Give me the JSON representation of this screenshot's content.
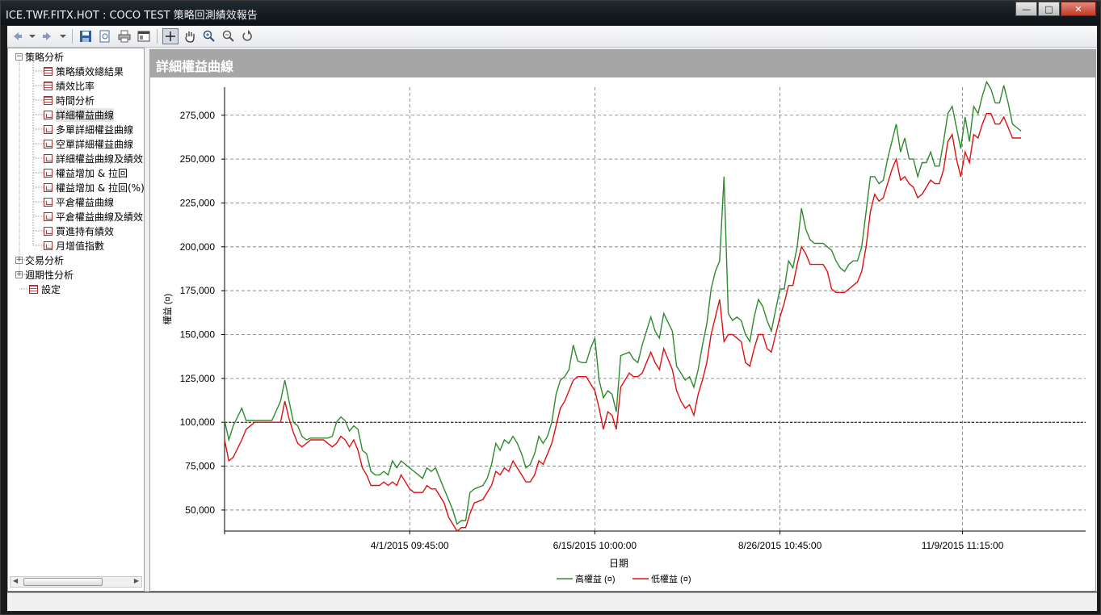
{
  "window": {
    "title": "ICE.TWF.FITX.HOT : COCO TEST 策略回測績效報告",
    "buttons": {
      "minimize": "—",
      "maximize": "□",
      "close": "✕"
    }
  },
  "toolbar": {
    "items": [
      "back-icon",
      "dropdown-icon",
      "forward-icon",
      "dropdown-icon",
      "save-icon",
      "export-icon",
      "print-icon",
      "settings-icon",
      "pointer-icon",
      "hand-pan-icon",
      "zoom-in-icon",
      "zoom-out-icon",
      "reset-zoom-icon"
    ]
  },
  "tree": {
    "root1": "策略分析",
    "children": [
      "策略績效總結果",
      "績效比率",
      "時間分析",
      "詳細權益曲線",
      "多單詳細權益曲線",
      "空單詳細權益曲線",
      "詳細權益曲線及績效",
      "權益增加 & 拉回",
      "權益增加 & 拉回(%)",
      "平倉權益曲線",
      "平倉權益曲線及績效",
      "買進持有績效",
      "月增值指數"
    ],
    "root2": "交易分析",
    "root3": "週期性分析",
    "root4": "設定"
  },
  "panel": {
    "title": "詳細權益曲線"
  },
  "chart_data": {
    "type": "line",
    "title": "",
    "xlabel": "日期",
    "ylabel": "權益 (¤)",
    "ylim": [
      38000,
      291000
    ],
    "yticks": [
      50000,
      75000,
      100000,
      125000,
      150000,
      175000,
      200000,
      225000,
      250000,
      275000
    ],
    "ytick_labels": [
      "50,000",
      "75,000",
      "100,000",
      "125,000",
      "150,000",
      "175,000",
      "200,000",
      "225,000",
      "250,000",
      "275,000"
    ],
    "xtick_labels": [
      "4/1/2015 09:45:00",
      "6/15/2015 10:00:00",
      "8/26/2015 10:45:00",
      "11/9/2015 11:15:00"
    ],
    "xtick_positions": [
      0.215,
      0.43,
      0.645,
      0.857
    ],
    "reference_line": 100000,
    "grid": true,
    "legend_position": "bottom-center",
    "colors": {
      "high": "#2e8b2e",
      "low": "#dd1111"
    },
    "series": [
      {
        "name": "高權益 (¤)",
        "color": "#2e8b2e"
      },
      {
        "name": "低權益 (¤)",
        "color": "#dd1111"
      }
    ],
    "x": [
      0,
      0.005,
      0.01,
      0.02,
      0.025,
      0.035,
      0.045,
      0.05,
      0.055,
      0.065,
      0.07,
      0.075,
      0.08,
      0.085,
      0.09,
      0.095,
      0.1,
      0.11,
      0.115,
      0.12,
      0.125,
      0.13,
      0.135,
      0.14,
      0.145,
      0.15,
      0.155,
      0.16,
      0.165,
      0.17,
      0.175,
      0.18,
      0.185,
      0.19,
      0.195,
      0.2,
      0.205,
      0.21,
      0.215,
      0.22,
      0.225,
      0.23,
      0.235,
      0.24,
      0.245,
      0.25,
      0.255,
      0.26,
      0.265,
      0.27,
      0.275,
      0.28,
      0.285,
      0.29,
      0.3,
      0.305,
      0.31,
      0.315,
      0.32,
      0.325,
      0.33,
      0.335,
      0.34,
      0.345,
      0.35,
      0.355,
      0.36,
      0.365,
      0.37,
      0.375,
      0.38,
      0.385,
      0.39,
      0.395,
      0.4,
      0.405,
      0.41,
      0.415,
      0.42,
      0.425,
      0.43,
      0.435,
      0.44,
      0.445,
      0.45,
      0.455,
      0.46,
      0.47,
      0.475,
      0.48,
      0.485,
      0.49,
      0.495,
      0.5,
      0.505,
      0.51,
      0.52,
      0.525,
      0.53,
      0.535,
      0.54,
      0.545,
      0.55,
      0.555,
      0.56,
      0.565,
      0.57,
      0.575,
      0.58,
      0.585,
      0.59,
      0.595,
      0.6,
      0.605,
      0.61,
      0.615,
      0.62,
      0.625,
      0.63,
      0.635,
      0.64,
      0.645,
      0.65,
      0.655,
      0.66,
      0.665,
      0.67,
      0.675,
      0.68,
      0.685,
      0.69,
      0.695,
      0.7,
      0.705,
      0.71,
      0.715,
      0.72,
      0.725,
      0.73,
      0.735,
      0.74,
      0.745,
      0.75,
      0.755,
      0.76,
      0.765,
      0.77,
      0.775,
      0.78,
      0.785,
      0.79,
      0.795,
      0.8,
      0.805,
      0.81,
      0.815,
      0.82,
      0.825,
      0.83,
      0.835,
      0.84,
      0.845,
      0.85,
      0.855,
      0.86,
      0.865,
      0.87,
      0.875,
      0.88,
      0.885,
      0.89,
      0.895,
      0.9,
      0.905,
      0.91,
      0.915,
      0.92,
      0.925,
      0.93,
      0.935,
      0.94,
      0.945,
      0.95,
      0.955,
      0.96,
      0.965,
      0.97,
      0.975,
      0.98,
      0.985,
      0.99,
      0.995,
      1.0
    ],
    "high": [
      101000,
      90000,
      98000,
      108000,
      101000,
      101000,
      101000,
      101000,
      101000,
      112000,
      124000,
      112000,
      100000,
      98000,
      92000,
      90000,
      91000,
      91000,
      91000,
      91000,
      92000,
      100000,
      103000,
      101000,
      95000,
      98000,
      96000,
      84000,
      82000,
      72000,
      70000,
      70000,
      72000,
      70000,
      78000,
      74000,
      78000,
      76000,
      74000,
      72000,
      70000,
      68000,
      74000,
      72000,
      74000,
      68000,
      62000,
      56000,
      50000,
      42000,
      44000,
      44000,
      60000,
      62000,
      64000,
      68000,
      76000,
      88000,
      84000,
      90000,
      88000,
      92000,
      88000,
      82000,
      74000,
      76000,
      82000,
      92000,
      88000,
      92000,
      100000,
      116000,
      124000,
      126000,
      130000,
      144000,
      135000,
      134000,
      134000,
      142000,
      148000,
      124000,
      114000,
      118000,
      116000,
      106000,
      138000,
      140000,
      136000,
      134000,
      144000,
      152000,
      160000,
      152000,
      148000,
      162000,
      152000,
      132000,
      128000,
      124000,
      126000,
      120000,
      130000,
      144000,
      156000,
      176000,
      186000,
      192000,
      240000,
      162000,
      158000,
      160000,
      158000,
      150000,
      146000,
      160000,
      170000,
      166000,
      158000,
      152000,
      164000,
      176000,
      176000,
      192000,
      188000,
      200000,
      222000,
      210000,
      204000,
      202000,
      202000,
      202000,
      200000,
      198000,
      192000,
      188000,
      186000,
      190000,
      192000,
      192000,
      200000,
      220000,
      240000,
      240000,
      236000,
      238000,
      250000,
      260000,
      270000,
      254000,
      262000,
      250000,
      250000,
      240000,
      248000,
      248000,
      254000,
      246000,
      246000,
      260000,
      276000,
      280000,
      268000,
      256000,
      274000,
      260000,
      280000,
      276000,
      286000,
      294000,
      290000,
      282000,
      282000,
      292000,
      282000,
      270000,
      268000,
      266000
    ],
    "low": [
      90000,
      78000,
      80000,
      90000,
      96000,
      100000,
      100000,
      100000,
      100000,
      100000,
      112000,
      102000,
      94000,
      88000,
      86000,
      88000,
      90000,
      90000,
      90000,
      88000,
      86000,
      88000,
      92000,
      90000,
      86000,
      90000,
      84000,
      74000,
      70000,
      64000,
      64000,
      64000,
      66000,
      64000,
      66000,
      64000,
      70000,
      66000,
      62000,
      60000,
      60000,
      60000,
      64000,
      62000,
      62000,
      58000,
      54000,
      46000,
      42000,
      38000,
      40000,
      40000,
      48000,
      54000,
      56000,
      60000,
      64000,
      72000,
      70000,
      74000,
      72000,
      78000,
      74000,
      70000,
      66000,
      66000,
      70000,
      78000,
      76000,
      82000,
      88000,
      98000,
      108000,
      112000,
      118000,
      124000,
      126000,
      126000,
      126000,
      122000,
      118000,
      108000,
      96000,
      106000,
      104000,
      96000,
      120000,
      128000,
      126000,
      126000,
      128000,
      134000,
      140000,
      134000,
      130000,
      142000,
      130000,
      118000,
      112000,
      108000,
      110000,
      104000,
      116000,
      124000,
      134000,
      150000,
      160000,
      170000,
      146000,
      150000,
      150000,
      148000,
      146000,
      134000,
      132000,
      142000,
      150000,
      150000,
      142000,
      140000,
      150000,
      160000,
      168000,
      178000,
      178000,
      190000,
      200000,
      196000,
      190000,
      190000,
      190000,
      190000,
      186000,
      176000,
      174000,
      174000,
      174000,
      176000,
      178000,
      180000,
      186000,
      200000,
      220000,
      230000,
      226000,
      228000,
      236000,
      244000,
      250000,
      238000,
      240000,
      236000,
      234000,
      228000,
      230000,
      234000,
      238000,
      236000,
      236000,
      244000,
      260000,
      264000,
      250000,
      240000,
      254000,
      248000,
      264000,
      262000,
      270000,
      276000,
      276000,
      270000,
      270000,
      274000,
      268000,
      262000,
      262000,
      262000
    ]
  },
  "statusbar": {
    "text": ""
  }
}
